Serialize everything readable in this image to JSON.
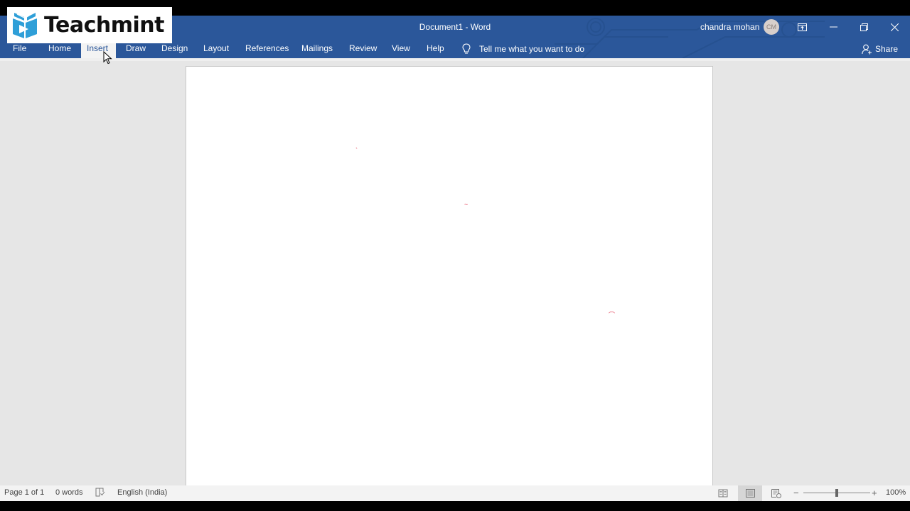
{
  "watermark": {
    "brand": "Teachmint",
    "icon": "book-play-icon",
    "color": "#2f9fd8"
  },
  "window": {
    "title": "Document1  -  Word",
    "user_name": "chandra mohan",
    "user_initials": "CM",
    "controls": [
      "ribbon-display-options",
      "minimize",
      "restore",
      "close"
    ]
  },
  "ribbon": {
    "tabs": [
      {
        "label": "File"
      },
      {
        "label": "Home"
      },
      {
        "label": "Insert",
        "active": true
      },
      {
        "label": "Draw"
      },
      {
        "label": "Design"
      },
      {
        "label": "Layout"
      },
      {
        "label": "References"
      },
      {
        "label": "Mailings"
      },
      {
        "label": "Review"
      },
      {
        "label": "View"
      },
      {
        "label": "Help"
      }
    ],
    "tell_me": "Tell me what you want to do",
    "share": "Share"
  },
  "statusbar": {
    "page": "Page 1 of 1",
    "words": "0 words",
    "language": "English (India)",
    "views": [
      "read-mode",
      "print-layout",
      "web-layout"
    ],
    "active_view": "print-layout",
    "zoom_minus": "−",
    "zoom_plus": "+",
    "zoom_level": "100%",
    "zoom_percent": 100
  },
  "colors": {
    "accent": "#2b579a",
    "workspace": "#e6e6e6",
    "statusbar": "#f3f3f3"
  }
}
